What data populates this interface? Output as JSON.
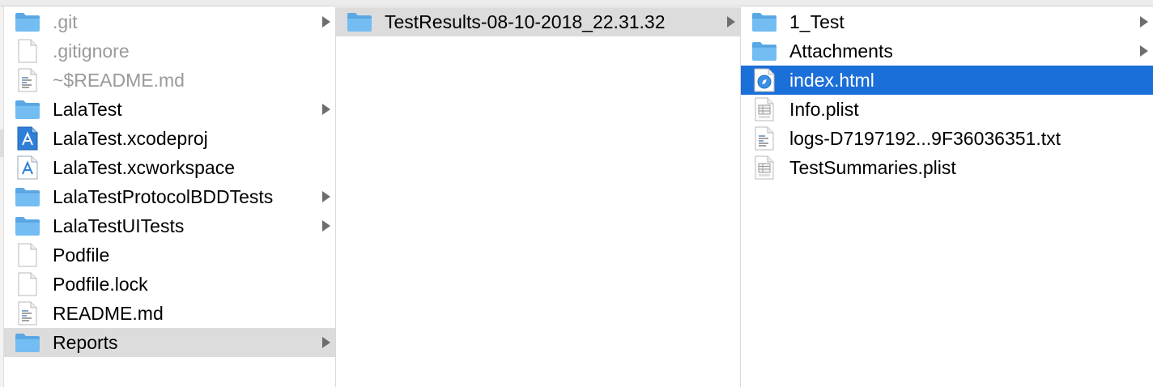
{
  "window": {
    "title": ""
  },
  "columns": [
    {
      "items": [
        {
          "label": ".git",
          "icon": "folder-icon",
          "has_children": true,
          "dim": true,
          "state": ""
        },
        {
          "label": ".gitignore",
          "icon": "document-icon",
          "has_children": false,
          "dim": true,
          "state": ""
        },
        {
          "label": "~$README.md",
          "icon": "text-document-icon",
          "has_children": false,
          "dim": true,
          "state": ""
        },
        {
          "label": "LalaTest",
          "icon": "folder-icon",
          "has_children": true,
          "dim": false,
          "state": ""
        },
        {
          "label": "LalaTest.xcodeproj",
          "icon": "xcode-project-icon",
          "has_children": false,
          "dim": false,
          "state": ""
        },
        {
          "label": "LalaTest.xcworkspace",
          "icon": "xcode-workspace-icon",
          "has_children": false,
          "dim": false,
          "state": ""
        },
        {
          "label": "LalaTestProtocolBDDTests",
          "icon": "folder-icon",
          "has_children": true,
          "dim": false,
          "state": ""
        },
        {
          "label": "LalaTestUITests",
          "icon": "folder-icon",
          "has_children": true,
          "dim": false,
          "state": ""
        },
        {
          "label": "Podfile",
          "icon": "document-icon",
          "has_children": false,
          "dim": false,
          "state": ""
        },
        {
          "label": "Podfile.lock",
          "icon": "document-icon",
          "has_children": false,
          "dim": false,
          "state": ""
        },
        {
          "label": "README.md",
          "icon": "text-document-icon",
          "has_children": false,
          "dim": false,
          "state": ""
        },
        {
          "label": "Reports",
          "icon": "folder-icon",
          "has_children": true,
          "dim": false,
          "state": "path"
        }
      ]
    },
    {
      "items": [
        {
          "label": "TestResults-08-10-2018_22.31.32",
          "icon": "folder-icon",
          "has_children": true,
          "dim": false,
          "state": "path"
        }
      ]
    },
    {
      "items": [
        {
          "label": "1_Test",
          "icon": "folder-icon",
          "has_children": true,
          "dim": false,
          "state": ""
        },
        {
          "label": "Attachments",
          "icon": "folder-icon",
          "has_children": true,
          "dim": false,
          "state": ""
        },
        {
          "label": "index.html",
          "icon": "safari-html-icon",
          "has_children": false,
          "dim": false,
          "state": "selected"
        },
        {
          "label": "Info.plist",
          "icon": "plist-icon",
          "has_children": false,
          "dim": false,
          "state": ""
        },
        {
          "label": "logs-D7197192...9F36036351.txt",
          "icon": "text-document-icon",
          "has_children": false,
          "dim": false,
          "state": ""
        },
        {
          "label": "TestSummaries.plist",
          "icon": "plist-icon",
          "has_children": false,
          "dim": false,
          "state": ""
        }
      ]
    }
  ],
  "colors": {
    "selection": "#1b6fd9",
    "path_highlight": "#dcdcdc",
    "folder": "#6cb8f0",
    "dim_text": "#9a9a9a"
  }
}
